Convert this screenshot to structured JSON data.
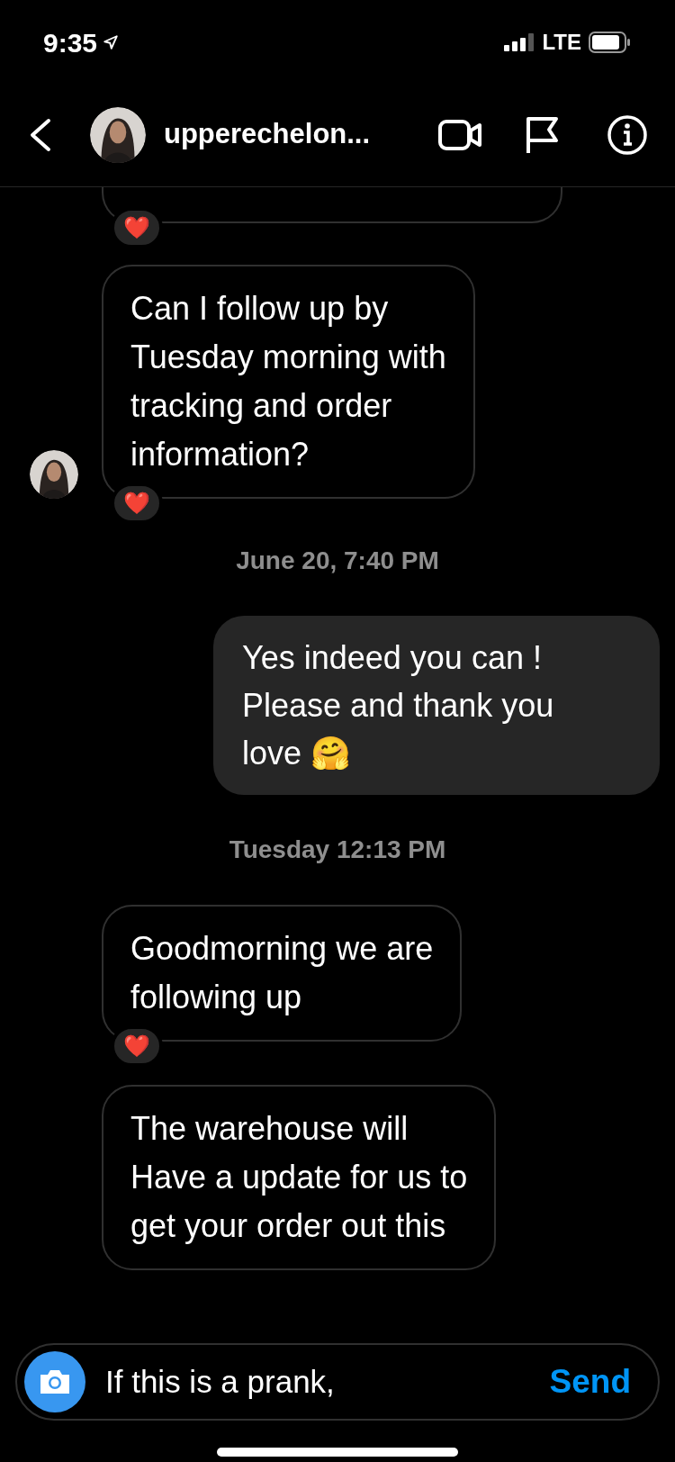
{
  "status_bar": {
    "time": "9:35",
    "network": "LTE"
  },
  "header": {
    "username": "upperechelon..."
  },
  "messages": [
    {
      "kind": "partial",
      "reaction": "❤️"
    },
    {
      "kind": "received",
      "text": "Can I follow up by\nTuesday morning with\ntracking and order\ninformation?",
      "reaction": "❤️",
      "show_avatar": true
    },
    {
      "kind": "timestamp",
      "text": "June 20, 7:40 PM"
    },
    {
      "kind": "sent",
      "text": "Yes indeed you can !\nPlease and thank you\nlove 🤗"
    },
    {
      "kind": "timestamp",
      "text": "Tuesday 12:13 PM"
    },
    {
      "kind": "received",
      "text": "Goodmorning we are\nfollowing up",
      "reaction": "❤️",
      "show_avatar": false
    },
    {
      "kind": "received",
      "text": "The warehouse will\nHave a update for us to\nget your order out this",
      "show_avatar": false
    }
  ],
  "composer": {
    "value": "If this is a prank,",
    "send_label": "Send"
  }
}
